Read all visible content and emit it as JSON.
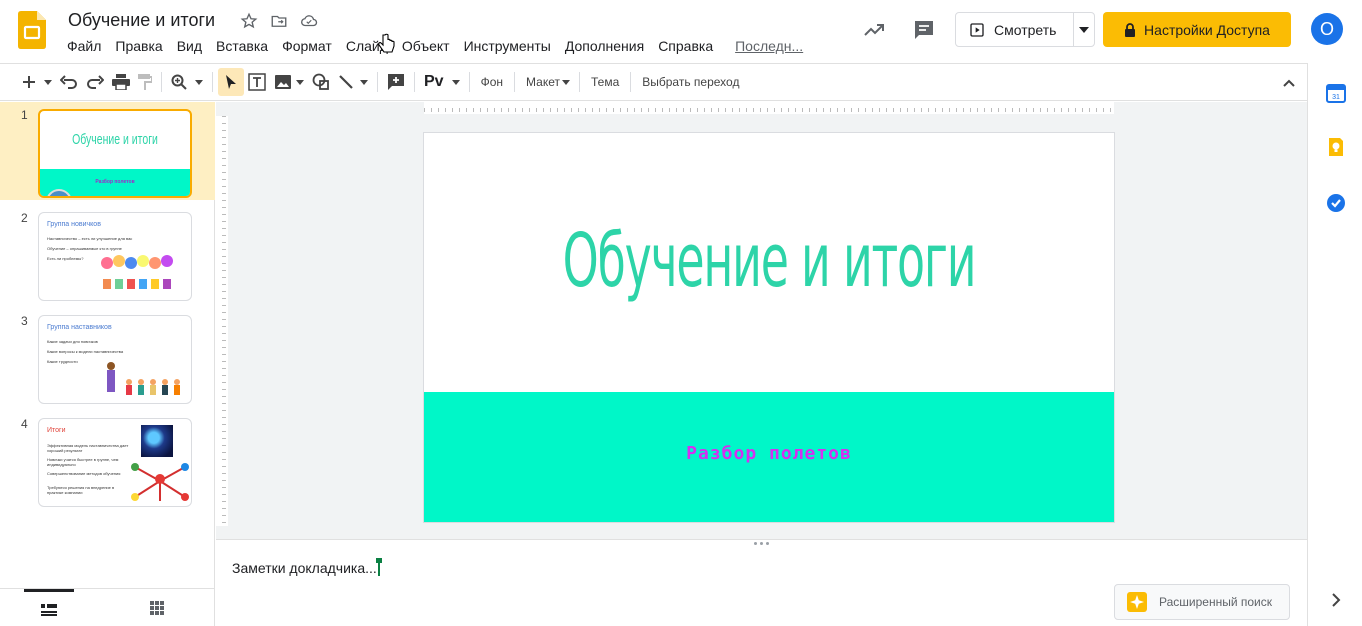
{
  "header": {
    "title": "Обучение и итоги",
    "menu": [
      "Файл",
      "Правка",
      "Вид",
      "Вставка",
      "Формат",
      "Слайд",
      "Объект",
      "Инструменты",
      "Дополнения",
      "Справка"
    ],
    "last_edit": "Последн...",
    "present_label": "Смотреть",
    "share_label": "Настройки Доступа",
    "avatar_letter": "O",
    "brand_color": "#fbbc04"
  },
  "toolbar": {
    "background_label": "Фон",
    "layout_label": "Макет",
    "theme_label": "Тема",
    "transition_label": "Выбрать переход"
  },
  "filmstrip": {
    "slides": [
      {
        "number": "1",
        "title": "Обучение и итоги",
        "subtitle": "Разбор полетов"
      },
      {
        "number": "2",
        "title": "Группа новичков",
        "lines": [
          "Наставничество – есть ли улучшение для вас",
          "Обучение – опрашиваемые кто в группе",
          "Есть ли проблемы?"
        ]
      },
      {
        "number": "3",
        "title": "Группа наставников",
        "lines": [
          "Какие задачи для новичков",
          "Какие вопросы к модели наставничества",
          "Какие трудности"
        ]
      },
      {
        "number": "4",
        "title": "Итоги",
        "lines": [
          "Эффективная модель наставничества дает хороший результат",
          "Новички учатся быстрее в группе, чем индивидуально",
          "Совершенствование методов обучения",
          "Требуются решения на внедрение в практике компании"
        ]
      }
    ]
  },
  "slide": {
    "title": "Обучение и итоги",
    "subtitle": "Разбор полетов",
    "title_color": "#2dd4a8",
    "band_color": "#00f7c8",
    "subtitle_color": "#d42ff0"
  },
  "notes": {
    "placeholder": "Заметки докладчика...",
    "explore_label": "Расширенный поиск"
  }
}
